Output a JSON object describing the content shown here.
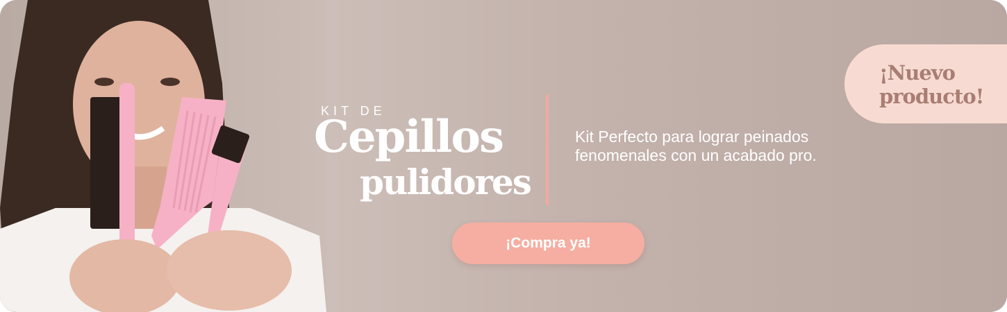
{
  "banner": {
    "kit_label": "KIT DE",
    "title_line1": "Cepillos",
    "title_line2": "pulidores",
    "description": "Kit Perfecto para lograr peinados fenomenales con un acabado pro.",
    "cta_label": "¡Compra ya!",
    "badge_line1": "¡Nuevo",
    "badge_line2": "producto!"
  },
  "photo": {
    "subject": "woman holding pink styling brush, comb and edge brush",
    "icons": [
      "bristle-brush-icon",
      "comb-icon",
      "edge-brush-icon"
    ]
  },
  "colors": {
    "background": "#c9bab4",
    "accent": "#f5aea1",
    "badge_background": "#f7dbd3",
    "badge_text": "#a97d72",
    "tool_pink": "#f6b1c6"
  }
}
